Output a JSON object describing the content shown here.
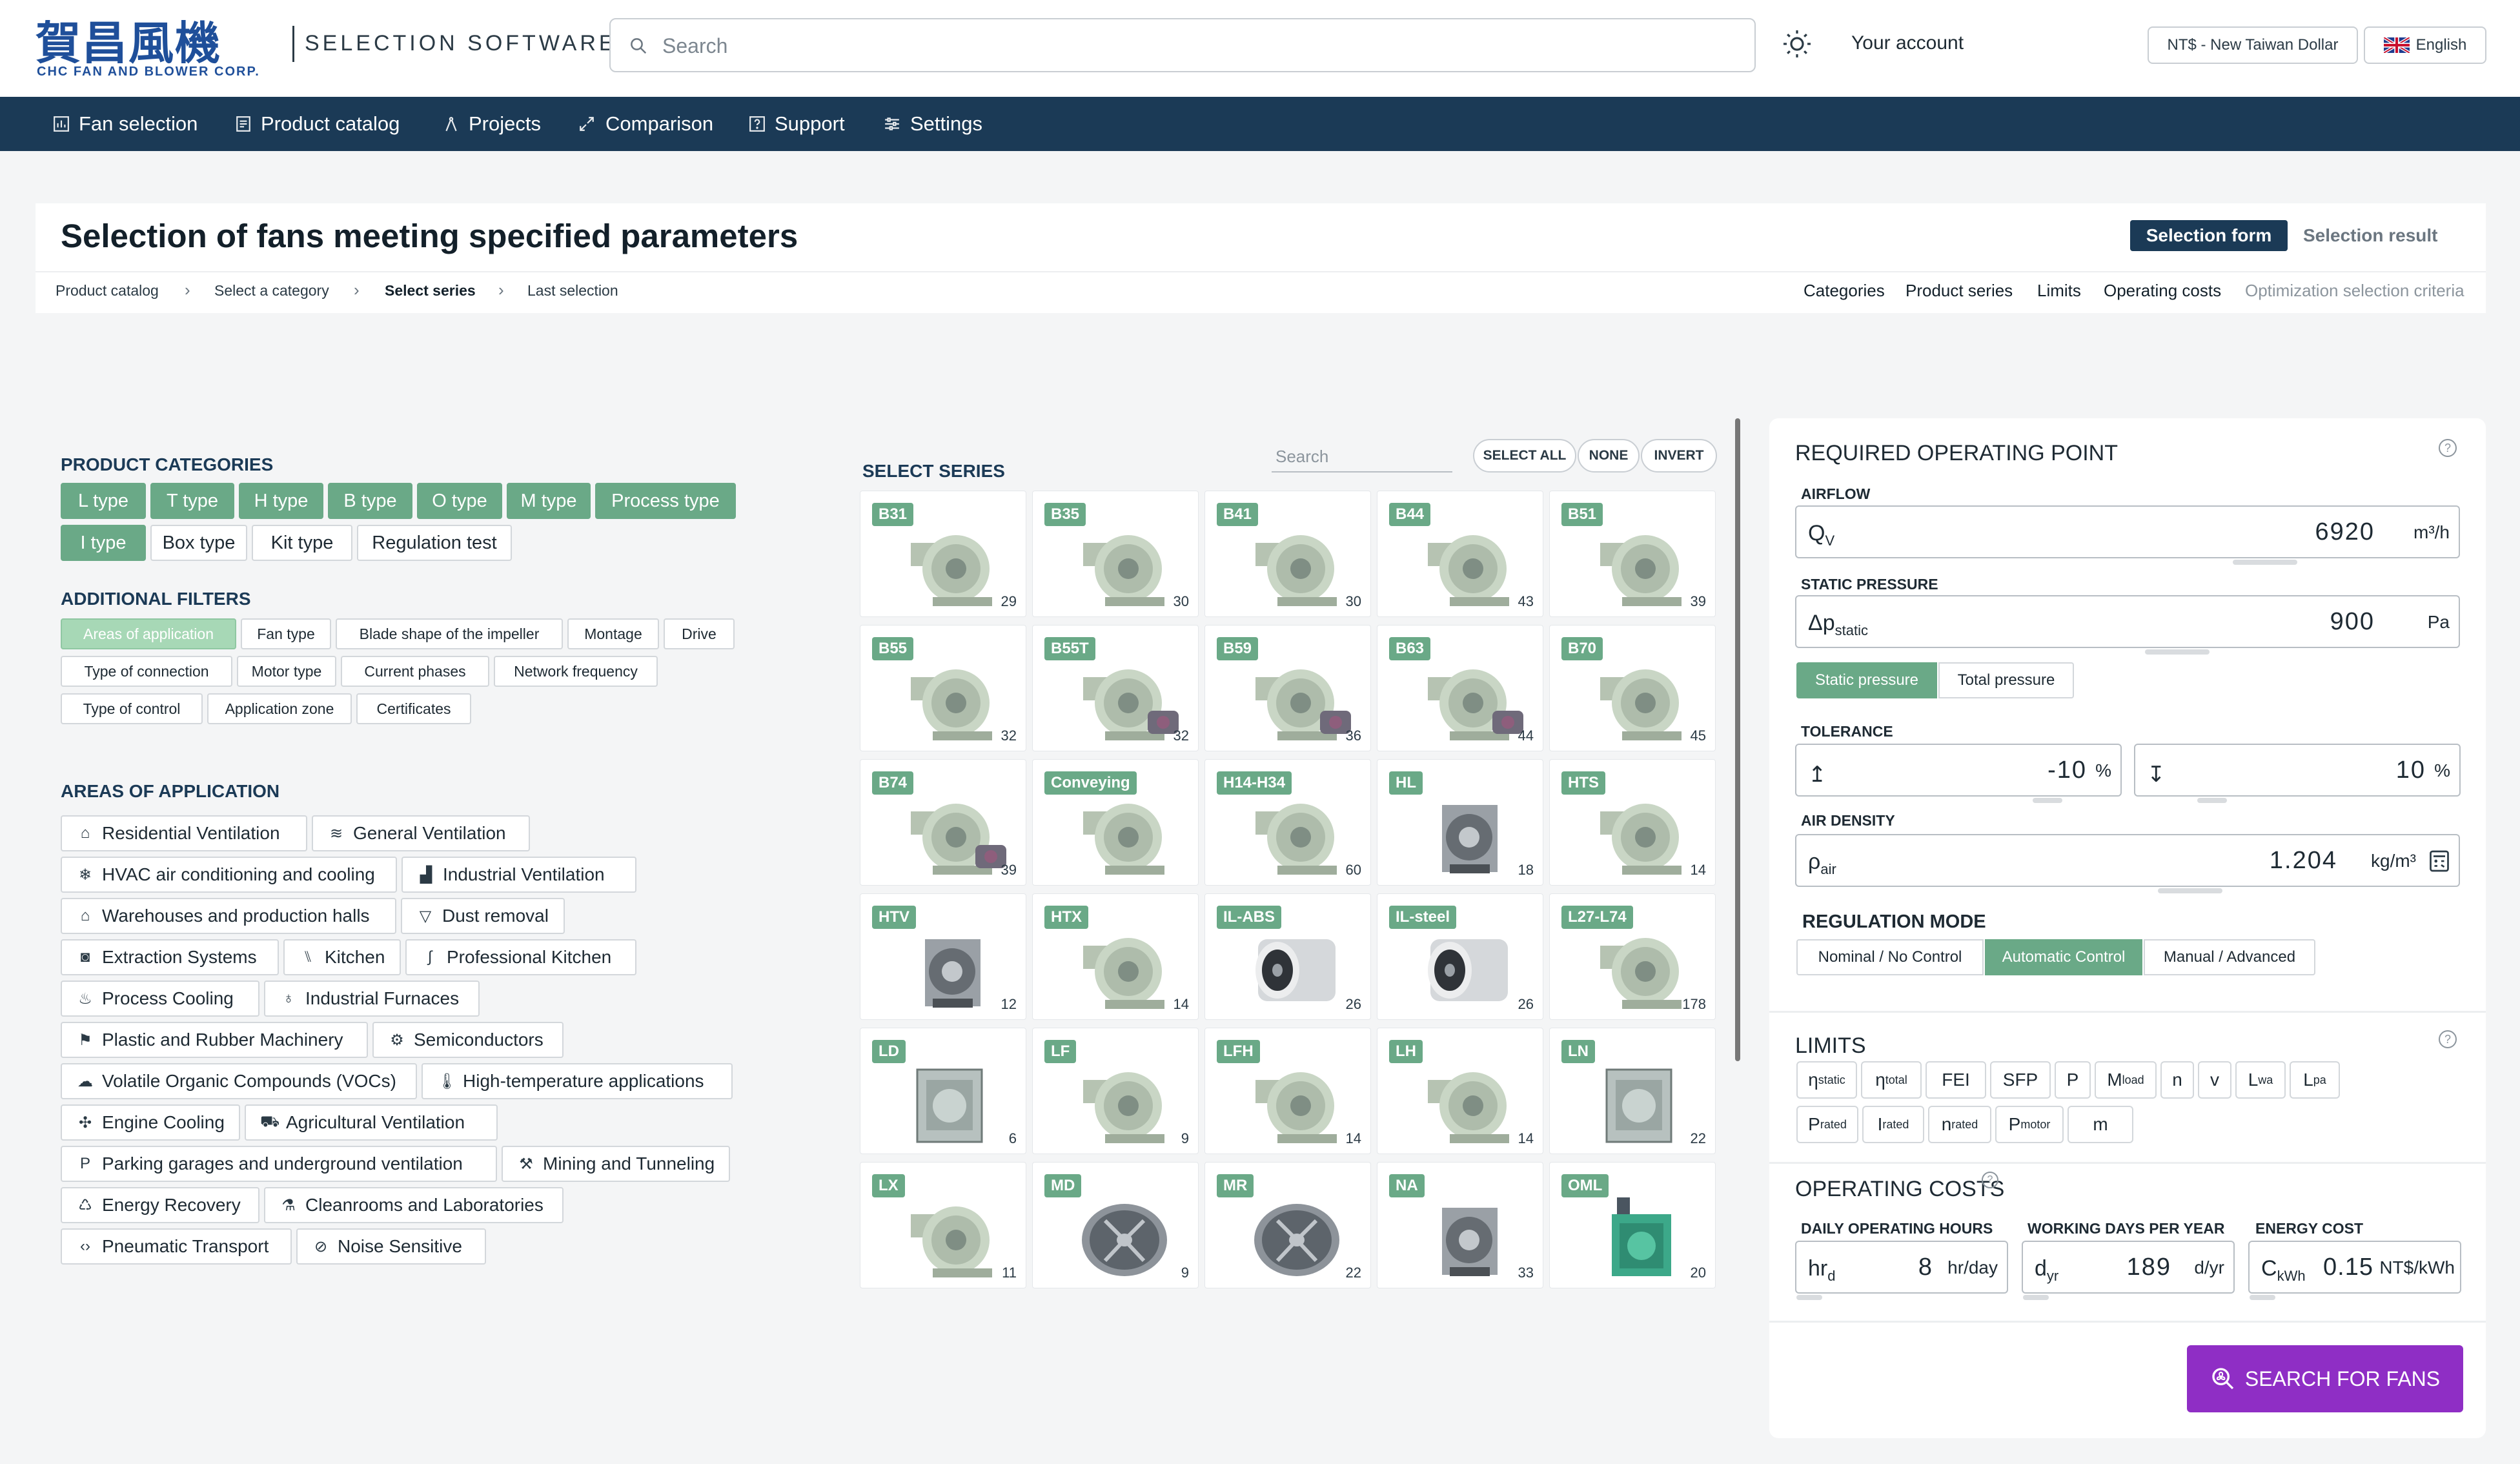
{
  "brand": {
    "logo_cn": "賀昌風機",
    "logo_en": "CHC FAN AND BLOWER CORP.",
    "subtitle": "SELECTION SOFTWARE"
  },
  "header": {
    "search_placeholder": "Search",
    "account": "Your account",
    "currency": "NT$ - New Taiwan Dollar",
    "language": "English"
  },
  "nav": [
    {
      "label": "Fan selection",
      "icon": "chart-icon"
    },
    {
      "label": "Product catalog",
      "icon": "catalog-icon"
    },
    {
      "label": "Projects",
      "icon": "compass-icon"
    },
    {
      "label": "Comparison",
      "icon": "compare-icon"
    },
    {
      "label": "Support",
      "icon": "help-icon"
    },
    {
      "label": "Settings",
      "icon": "sliders-icon"
    }
  ],
  "page": {
    "title": "Selection of fans meeting specified parameters",
    "tabs": [
      "Selection form",
      "Selection result"
    ],
    "breadcrumb": [
      "Product catalog",
      "Select a category",
      "Select series",
      "Last selection"
    ],
    "section_links": [
      "Categories",
      "Product series",
      "Limits",
      "Operating costs",
      "Optimization selection criteria"
    ]
  },
  "product_categories": {
    "title": "PRODUCT CATEGORIES",
    "items": [
      {
        "label": "L type",
        "selected": true
      },
      {
        "label": "T type",
        "selected": true
      },
      {
        "label": "H type",
        "selected": true
      },
      {
        "label": "B type",
        "selected": true
      },
      {
        "label": "O type",
        "selected": true
      },
      {
        "label": "M type",
        "selected": true
      },
      {
        "label": "Process type",
        "selected": true
      },
      {
        "label": "I type",
        "selected": true
      },
      {
        "label": "Box type",
        "selected": false
      },
      {
        "label": "Kit type",
        "selected": false
      },
      {
        "label": "Regulation test",
        "selected": false
      }
    ]
  },
  "additional_filters": {
    "title": "ADDITIONAL FILTERS",
    "items": [
      "Areas of application",
      "Fan type",
      "Blade shape of the impeller",
      "Montage",
      "Drive",
      "Type of connection",
      "Motor type",
      "Current phases",
      "Network frequency",
      "Type of control",
      "Application zone",
      "Certificates"
    ],
    "active": "Areas of application"
  },
  "areas_of_application": {
    "title": "AREAS OF APPLICATION",
    "items": [
      {
        "label": "Residential Ventilation",
        "icon": "home-icon"
      },
      {
        "label": "General Ventilation",
        "icon": "wind-icon"
      },
      {
        "label": "HVAC air conditioning and cooling",
        "icon": "snowflake-icon"
      },
      {
        "label": "Industrial Ventilation",
        "icon": "factory-icon"
      },
      {
        "label": "Warehouses and production halls",
        "icon": "warehouse-icon"
      },
      {
        "label": "Dust removal",
        "icon": "filter-icon"
      },
      {
        "label": "Extraction Systems",
        "icon": "extraction-icon"
      },
      {
        "label": "Kitchen",
        "icon": "utensils-icon"
      },
      {
        "label": "Professional Kitchen",
        "icon": "chef-icon"
      },
      {
        "label": "Process Cooling",
        "icon": "cooling-icon"
      },
      {
        "label": "Industrial Furnaces",
        "icon": "flame-icon"
      },
      {
        "label": "Plastic and Rubber Machinery",
        "icon": "machinery-icon"
      },
      {
        "label": "Semiconductors",
        "icon": "chip-icon"
      },
      {
        "label": "Volatile Organic Compounds (VOCs)",
        "icon": "cloud-icon"
      },
      {
        "label": "High-temperature applications",
        "icon": "thermometer-icon"
      },
      {
        "label": "Engine Cooling",
        "icon": "fan-icon"
      },
      {
        "label": "Agricultural Ventilation",
        "icon": "tractor-icon"
      },
      {
        "label": "Parking garages and underground ventilation",
        "icon": "parking-icon"
      },
      {
        "label": "Mining and Tunneling",
        "icon": "pickaxe-icon"
      },
      {
        "label": "Energy Recovery",
        "icon": "recycle-icon"
      },
      {
        "label": "Cleanrooms and Laboratories",
        "icon": "flask-icon"
      },
      {
        "label": "Pneumatic Transport",
        "icon": "code-icon"
      },
      {
        "label": "Noise Sensitive",
        "icon": "mute-icon"
      }
    ]
  },
  "series": {
    "title": "SELECT SERIES",
    "search_placeholder": "Search",
    "buttons": [
      "SELECT ALL",
      "NONE",
      "INVERT"
    ],
    "items": [
      {
        "name": "B31",
        "count": "29",
        "kind": "centrifugal"
      },
      {
        "name": "B35",
        "count": "30",
        "kind": "centrifugal"
      },
      {
        "name": "B41",
        "count": "30",
        "kind": "centrifugal"
      },
      {
        "name": "B44",
        "count": "43",
        "kind": "centrifugal"
      },
      {
        "name": "B51",
        "count": "39",
        "kind": "centrifugal"
      },
      {
        "name": "B55",
        "count": "32",
        "kind": "centrifugal"
      },
      {
        "name": "B55T",
        "count": "32",
        "kind": "belt"
      },
      {
        "name": "B59",
        "count": "36",
        "kind": "belt"
      },
      {
        "name": "B63",
        "count": "44",
        "kind": "belt"
      },
      {
        "name": "B70",
        "count": "45",
        "kind": "centrifugal"
      },
      {
        "name": "B74",
        "count": "39",
        "kind": "belt"
      },
      {
        "name": "Conveying",
        "count": "",
        "kind": "centrifugal"
      },
      {
        "name": "H14-H34",
        "count": "60",
        "kind": "centrifugal"
      },
      {
        "name": "HL",
        "count": "18",
        "kind": "dark"
      },
      {
        "name": "HTS",
        "count": "14",
        "kind": "centrifugal"
      },
      {
        "name": "HTV",
        "count": "12",
        "kind": "dark"
      },
      {
        "name": "HTX",
        "count": "14",
        "kind": "centrifugal"
      },
      {
        "name": "IL-ABS",
        "count": "26",
        "kind": "inline"
      },
      {
        "name": "IL-steel",
        "count": "26",
        "kind": "inline"
      },
      {
        "name": "L27-L74",
        "count": "178",
        "kind": "centrifugal"
      },
      {
        "name": "LD",
        "count": "6",
        "kind": "box"
      },
      {
        "name": "LF",
        "count": "9",
        "kind": "centrifugal"
      },
      {
        "name": "LFH",
        "count": "14",
        "kind": "centrifugal"
      },
      {
        "name": "LH",
        "count": "14",
        "kind": "centrifugal"
      },
      {
        "name": "LN",
        "count": "22",
        "kind": "box"
      },
      {
        "name": "LX",
        "count": "11",
        "kind": "centrifugal"
      },
      {
        "name": "MD",
        "count": "9",
        "kind": "axial"
      },
      {
        "name": "MR",
        "count": "22",
        "kind": "axial"
      },
      {
        "name": "NA",
        "count": "33",
        "kind": "dark"
      },
      {
        "name": "OML",
        "count": "20",
        "kind": "green"
      }
    ]
  },
  "operating_point": {
    "title": "REQUIRED OPERATING POINT",
    "airflow": {
      "label": "AIRFLOW",
      "symbol": "Q",
      "sub": "V",
      "value": "6920",
      "unit": "m³/h"
    },
    "static_pressure": {
      "label": "STATIC PRESSURE",
      "symbol": "Δp",
      "sub": "static",
      "value": "900",
      "unit": "Pa"
    },
    "pressure_modes": [
      "Static pressure",
      "Total pressure"
    ],
    "tolerance": {
      "label": "TOLERANCE",
      "low": "-10",
      "high": "10",
      "unit": "%"
    },
    "air_density": {
      "label": "AIR DENSITY",
      "symbol": "ρ",
      "sub": "air",
      "value": "1.204",
      "unit": "kg/m³"
    },
    "regulation": {
      "label": "REGULATION MODE",
      "options": [
        "Nominal / No Control",
        "Automatic Control",
        "Manual / Advanced"
      ],
      "selected": "Automatic Control"
    }
  },
  "limits": {
    "title": "LIMITS",
    "items": [
      {
        "sym": "η",
        "sub": "static"
      },
      {
        "sym": "η",
        "sub": "total"
      },
      {
        "sym": "FEI",
        "sub": ""
      },
      {
        "sym": "SFP",
        "sub": ""
      },
      {
        "sym": "P",
        "sub": ""
      },
      {
        "sym": "M",
        "sub": "load"
      },
      {
        "sym": "n",
        "sub": ""
      },
      {
        "sym": "v",
        "sub": ""
      },
      {
        "sym": "L",
        "sub": "wa"
      },
      {
        "sym": "L",
        "sub": "pa"
      },
      {
        "sym": "P",
        "sub": "rated"
      },
      {
        "sym": "I",
        "sub": "rated"
      },
      {
        "sym": "n",
        "sub": "rated"
      },
      {
        "sym": "P",
        "sub": "motor"
      },
      {
        "sym": "m",
        "sub": ""
      }
    ]
  },
  "operating_costs": {
    "title": "OPERATING COSTS",
    "hours": {
      "label": "DAILY OPERATING HOURS",
      "symbol": "hr",
      "sub": "d",
      "value": "8",
      "unit": "hr/day"
    },
    "days": {
      "label": "WORKING DAYS PER YEAR",
      "symbol": "d",
      "sub": "yr",
      "value": "189",
      "unit": "d/yr"
    },
    "energy": {
      "label": "ENERGY COST",
      "symbol": "C",
      "sub": "kWh",
      "value": "0.15",
      "unit": "NT$/kWh"
    }
  },
  "search_button": "SEARCH FOR FANS",
  "colors": {
    "navy": "#1b3a56",
    "green": "#6aa987",
    "purple": "#8f2ec5"
  }
}
